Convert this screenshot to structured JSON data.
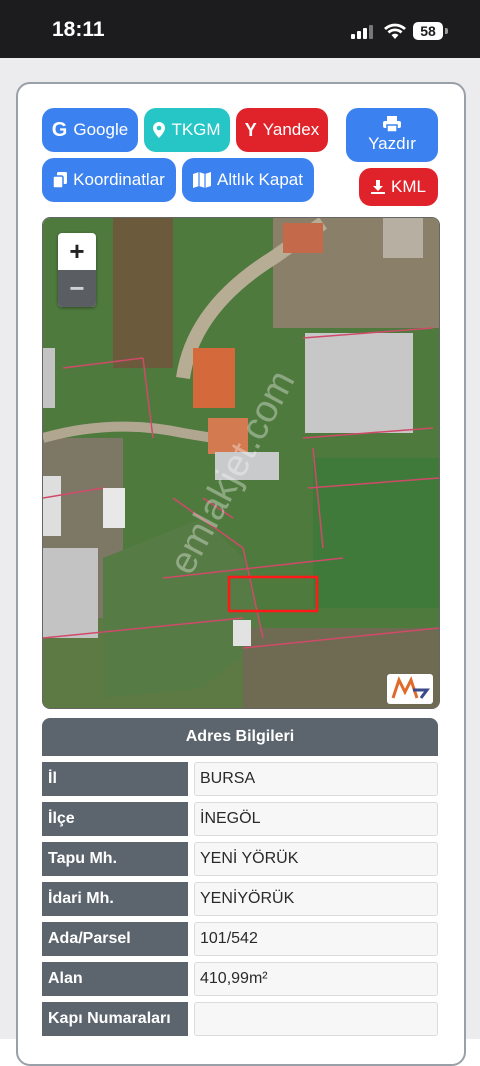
{
  "status_bar": {
    "time": "18:11",
    "battery": "58"
  },
  "toolbar": {
    "google": "Google",
    "tkgm": "TKGM",
    "yandex": "Yandex",
    "print": "Yazdır",
    "coordinates": "Koordinatlar",
    "close_base": "Altlık Kapat",
    "kml": "KML"
  },
  "map": {
    "zoom_in": "+",
    "zoom_out": "−",
    "watermark": "emlakjet.com"
  },
  "address": {
    "title": "Adres Bilgileri",
    "rows": [
      {
        "label": "İl",
        "value": "BURSA"
      },
      {
        "label": "İlçe",
        "value": "İNEGÖL"
      },
      {
        "label": "Tapu Mh.",
        "value": "YENİ YÖRÜK"
      },
      {
        "label": "İdari Mh.",
        "value": "YENİYÖRÜK"
      },
      {
        "label": "Ada/Parsel",
        "value": "101/542"
      },
      {
        "label": "Alan",
        "value": "410,99m²"
      },
      {
        "label": "Kapı Numaraları",
        "value": ""
      }
    ]
  },
  "colors": {
    "blue": "#3b82f0",
    "teal": "#26c6c6",
    "red": "#e0232b",
    "header": "#5c646d"
  }
}
